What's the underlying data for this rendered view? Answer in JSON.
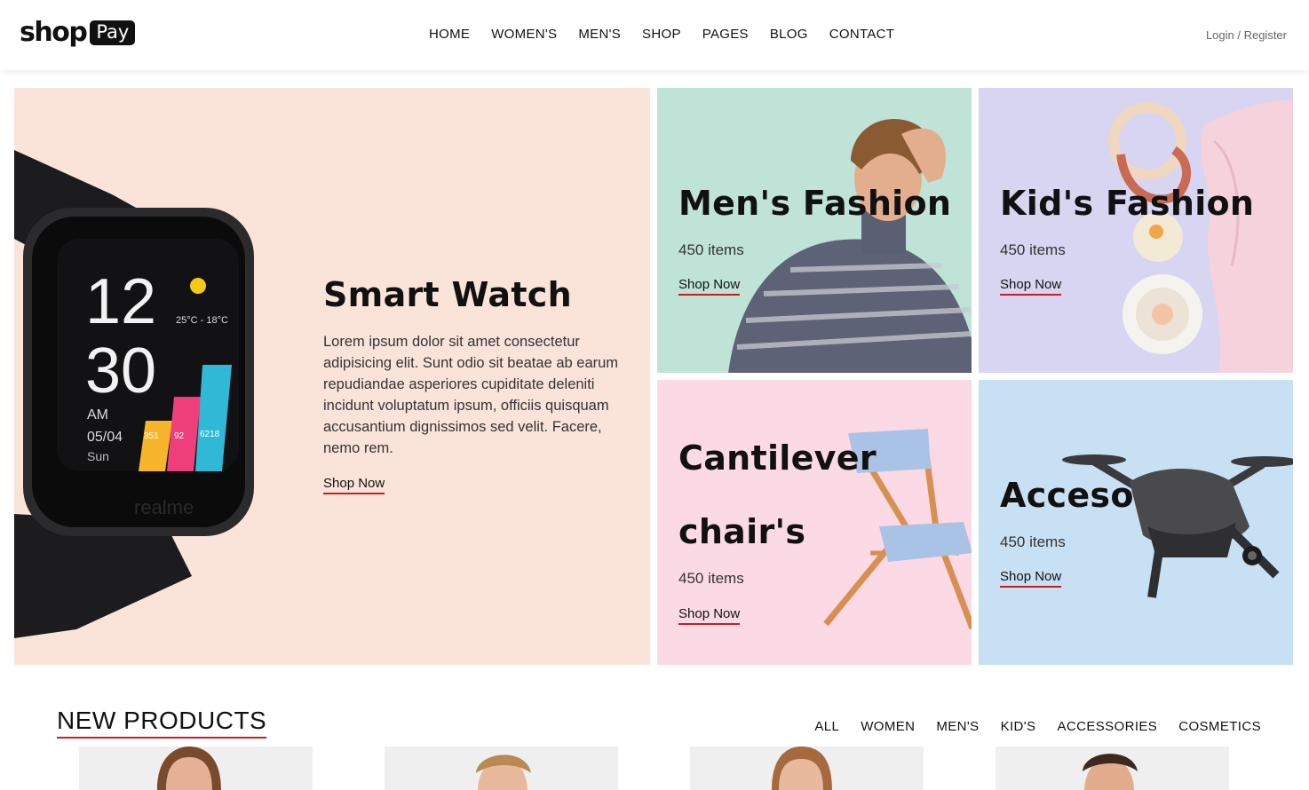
{
  "header": {
    "logo_word": "shop",
    "logo_badge": "Pay",
    "nav": [
      "HOME",
      "WOMEN'S",
      "MEN'S",
      "SHOP",
      "PAGES",
      "BLOG",
      "CONTACT"
    ],
    "login": "Login / Register"
  },
  "hero": {
    "title": "Smart Watch",
    "description": "Lorem ipsum dolor sit amet consectetur adipisicing elit. Sunt odio sit beatae ab earum repudiandae asperiores cupiditate deleniti incidunt voluptatum ipsum, officiis quisquam accusantium dignissimos sed velit. Facere, nemo rem.",
    "cta": "Shop Now",
    "watch": {
      "hour": "12",
      "minute": "30",
      "ampm": "AM",
      "date": "05/04",
      "day": "Sun",
      "temp": "25°C - 18°C",
      "stats": [
        "351",
        "92",
        "6218"
      ],
      "brand": "realme"
    }
  },
  "tiles": {
    "mens": {
      "title": "Men's Fashion",
      "count": "450 items",
      "cta": "Shop Now"
    },
    "kids": {
      "title": "Kid's Fashion",
      "count": "450 items",
      "cta": "Shop Now"
    },
    "chair": {
      "title_line1": "Cantilever",
      "title_line2": "chair's",
      "count": "450 items",
      "cta": "Shop Now"
    },
    "accessories": {
      "title": "Accesories",
      "count": "450 items",
      "cta": "Shop Now"
    }
  },
  "new_products": {
    "title": "NEW PRODUCTS",
    "filters": [
      "ALL",
      "WOMEN",
      "MEN'S",
      "KID'S",
      "ACCESSORIES",
      "COSMETICS"
    ]
  },
  "colors": {
    "accent": "#c81d25",
    "hero_bg": "#fae4da",
    "mens_bg": "#bfe3d6",
    "kids_bg": "#d7d5f1",
    "chair_bg": "#fcdae5",
    "accessories_bg": "#c8e0f4"
  }
}
